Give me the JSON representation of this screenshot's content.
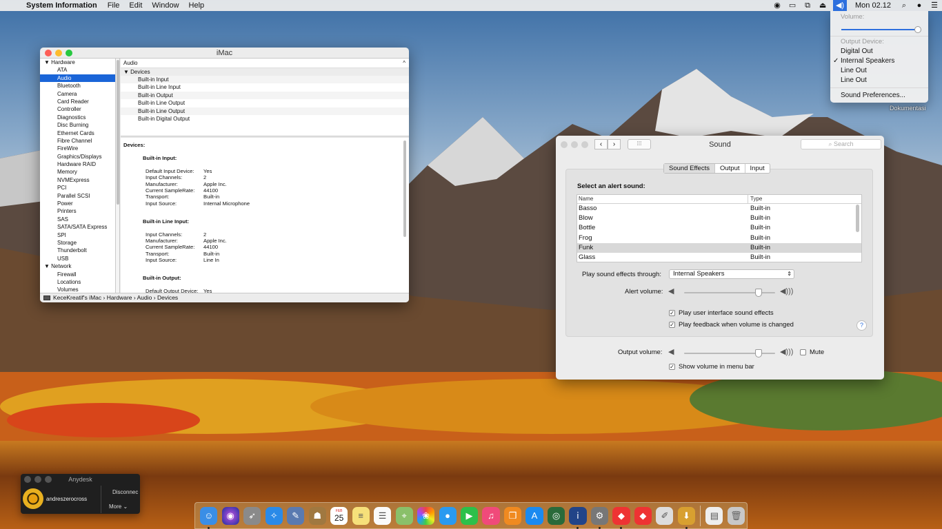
{
  "menubar": {
    "app_name": "System Information",
    "menus": [
      "File",
      "Edit",
      "Window",
      "Help"
    ],
    "clock": "Mon 02.12"
  },
  "volume_menu": {
    "volume_label": "Volume:",
    "volume_level": 1.0,
    "output_label": "Output Device:",
    "devices": [
      "Digital Out",
      "Internal Speakers",
      "Line Out",
      "Line Out"
    ],
    "selected_device": "Internal Speakers",
    "preferences": "Sound Preferences..."
  },
  "desktop": {
    "folder_label": "Dokumentasi"
  },
  "sysinfo": {
    "title": "iMac",
    "sidebar": [
      {
        "label": "Hardware",
        "group": true
      },
      {
        "label": "ATA"
      },
      {
        "label": "Audio",
        "selected": true
      },
      {
        "label": "Bluetooth"
      },
      {
        "label": "Camera"
      },
      {
        "label": "Card Reader"
      },
      {
        "label": "Controller"
      },
      {
        "label": "Diagnostics"
      },
      {
        "label": "Disc Burning"
      },
      {
        "label": "Ethernet Cards"
      },
      {
        "label": "Fibre Channel"
      },
      {
        "label": "FireWire"
      },
      {
        "label": "Graphics/Displays"
      },
      {
        "label": "Hardware RAID"
      },
      {
        "label": "Memory"
      },
      {
        "label": "NVMExpress"
      },
      {
        "label": "PCI"
      },
      {
        "label": "Parallel SCSI"
      },
      {
        "label": "Power"
      },
      {
        "label": "Printers"
      },
      {
        "label": "SAS"
      },
      {
        "label": "SATA/SATA Express"
      },
      {
        "label": "SPI"
      },
      {
        "label": "Storage"
      },
      {
        "label": "Thunderbolt"
      },
      {
        "label": "USB"
      },
      {
        "label": "Network",
        "group": true
      },
      {
        "label": "Firewall"
      },
      {
        "label": "Locations"
      },
      {
        "label": "Volumes"
      }
    ],
    "top_header": "Audio",
    "devices_group": "Devices",
    "device_list": [
      "Built-in Input",
      "Built-in Line Input",
      "Built-in Output",
      "Built-in Line Output",
      "Built-in Line Output",
      "Built-in Digital Output"
    ],
    "detail": {
      "heading": "Devices:",
      "sections": [
        {
          "title": "Built-in Input:",
          "rows": [
            [
              "Default Input Device:",
              "Yes"
            ],
            [
              "Input Channels:",
              "2"
            ],
            [
              "Manufacturer:",
              "Apple Inc."
            ],
            [
              "Current SampleRate:",
              "44100"
            ],
            [
              "Transport:",
              "Built-in"
            ],
            [
              "Input Source:",
              "Internal Microphone"
            ]
          ]
        },
        {
          "title": "Built-in Line Input:",
          "rows": [
            [
              "Input Channels:",
              "2"
            ],
            [
              "Manufacturer:",
              "Apple Inc."
            ],
            [
              "Current SampleRate:",
              "44100"
            ],
            [
              "Transport:",
              "Built-in"
            ],
            [
              "Input Source:",
              "Line In"
            ]
          ]
        },
        {
          "title": "Built-in Output:",
          "rows": [
            [
              "Default Output Device:",
              "Yes"
            ],
            [
              "Default System Output Device:",
              "Yes"
            ],
            [
              "Manufacturer:",
              "Apple Inc."
            ]
          ]
        }
      ]
    },
    "path": [
      "KeceKreatif's iMac",
      "Hardware",
      "Audio",
      "Devices"
    ]
  },
  "sound": {
    "title": "Sound",
    "search_placeholder": "Search",
    "tabs": [
      "Sound Effects",
      "Output",
      "Input"
    ],
    "active_tab": "Sound Effects",
    "alert_label": "Select an alert sound:",
    "columns": [
      "Name",
      "Type"
    ],
    "sounds": [
      {
        "name": "Basso",
        "type": "Built-in"
      },
      {
        "name": "Blow",
        "type": "Built-in"
      },
      {
        "name": "Bottle",
        "type": "Built-in"
      },
      {
        "name": "Frog",
        "type": "Built-in"
      },
      {
        "name": "Funk",
        "type": "Built-in",
        "selected": true
      },
      {
        "name": "Glass",
        "type": "Built-in"
      }
    ],
    "play_through_label": "Play sound effects through:",
    "play_through_value": "Internal Speakers",
    "alert_volume_label": "Alert volume:",
    "alert_volume": 0.82,
    "cb_ui_sounds": "Play user interface sound effects",
    "cb_feedback": "Play feedback when volume is changed",
    "output_volume_label": "Output volume:",
    "output_volume": 0.82,
    "mute_label": "Mute",
    "cb_show_volume": "Show volume in menu bar",
    "help": "?"
  },
  "anydesk": {
    "title": "Anydesk",
    "user": "andreszerocross",
    "disconnect": "Disconnec",
    "more": "More"
  },
  "dock": {
    "calendar_month": "FEB",
    "calendar_day": "25"
  }
}
